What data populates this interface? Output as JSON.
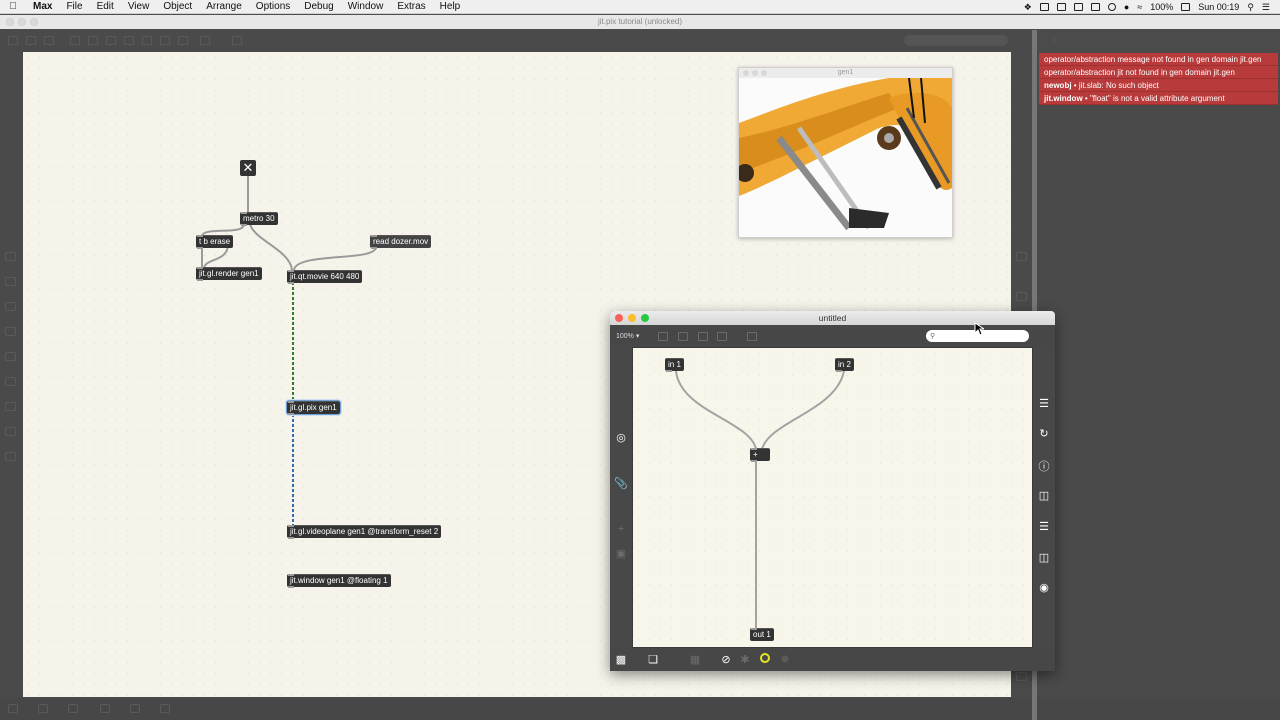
{
  "menubar": {
    "app": "Max",
    "items": [
      "File",
      "Edit",
      "View",
      "Object",
      "Arrange",
      "Options",
      "Debug",
      "Window",
      "Extras",
      "Help"
    ],
    "battery": "100%",
    "clock": "Sun 00:19"
  },
  "window": {
    "title": "jit.pix tutorial (unlocked)"
  },
  "patch": {
    "toggle_glyph": "✕",
    "objects": {
      "metro": "metro 30",
      "t_erase": "t b erase",
      "render": "jit.gl.render gen1",
      "read_msg": "read dozer.mov",
      "movie": "jit.qt.movie 640 480",
      "pix": "jit.gl.pix gen1",
      "videoplane": "jit.gl.videoplane gen1 @transform_reset 2",
      "jitwindow": "jit.window gen1 @floating 1"
    }
  },
  "jit_window": {
    "title": "gen1"
  },
  "gen_window": {
    "title": "untitled",
    "zoom": "100%",
    "objects": {
      "in1": "in 1",
      "in2": "in 2",
      "plus": "+",
      "out1": "out 1"
    }
  },
  "console": {
    "errors": [
      {
        "source": "",
        "message": "operator/abstraction message not found in gen domain jit.gen"
      },
      {
        "source": "",
        "message": "operator/abstraction jit not found in gen domain jit.gen"
      },
      {
        "source": "newobj",
        "message": "jit.slab: No such object"
      },
      {
        "source": "jit.window",
        "message": "\"float\" is not a valid attribute argument"
      }
    ]
  },
  "colors": {
    "error": "#b83a3a",
    "canvas": "#f6f4ea",
    "object": "#333333",
    "selection": "#6fa0d8"
  }
}
